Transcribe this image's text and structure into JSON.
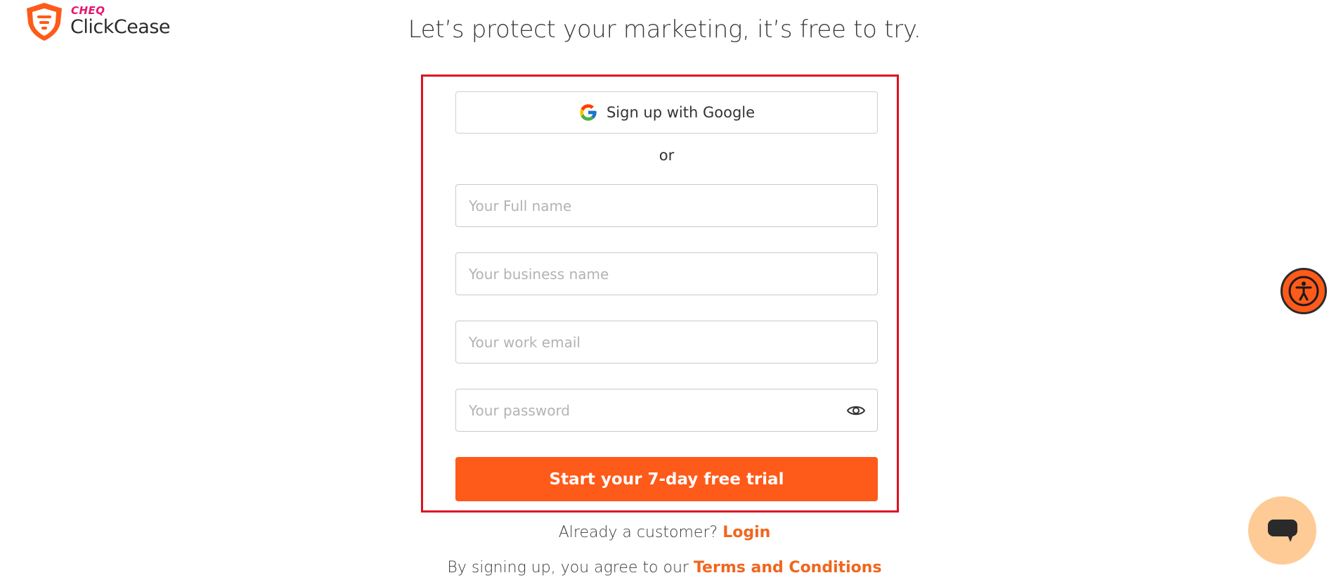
{
  "brand": {
    "cheq": "CHEQ",
    "name": "ClickCease"
  },
  "headline": "Let’s protect your marketing, it’s free to try.",
  "google_button": {
    "label": "Sign up with Google",
    "icon": "google-g-icon"
  },
  "divider": "or",
  "fields": {
    "full_name": {
      "placeholder": "Your Full name",
      "value": ""
    },
    "business_name": {
      "placeholder": "Your business name",
      "value": ""
    },
    "work_email": {
      "placeholder": "Your work email",
      "value": ""
    },
    "password": {
      "placeholder": "Your password",
      "value": "",
      "toggle_icon": "eye-icon"
    }
  },
  "cta": {
    "label": "Start your 7-day free trial"
  },
  "login_prompt": {
    "text": "Already a customer?",
    "link": "Login"
  },
  "terms": {
    "text": "By signing up, you agree to our",
    "link": "Terms and Conditions"
  },
  "widgets": {
    "accessibility_icon": "accessibility-icon",
    "chat_icon": "chat-bubble-icon"
  },
  "colors": {
    "accent": "#fe5a19",
    "link": "#f0661e",
    "brand_pink": "#e6156f",
    "highlight_frame": "#e01020",
    "chat_bg": "#fecb96"
  }
}
